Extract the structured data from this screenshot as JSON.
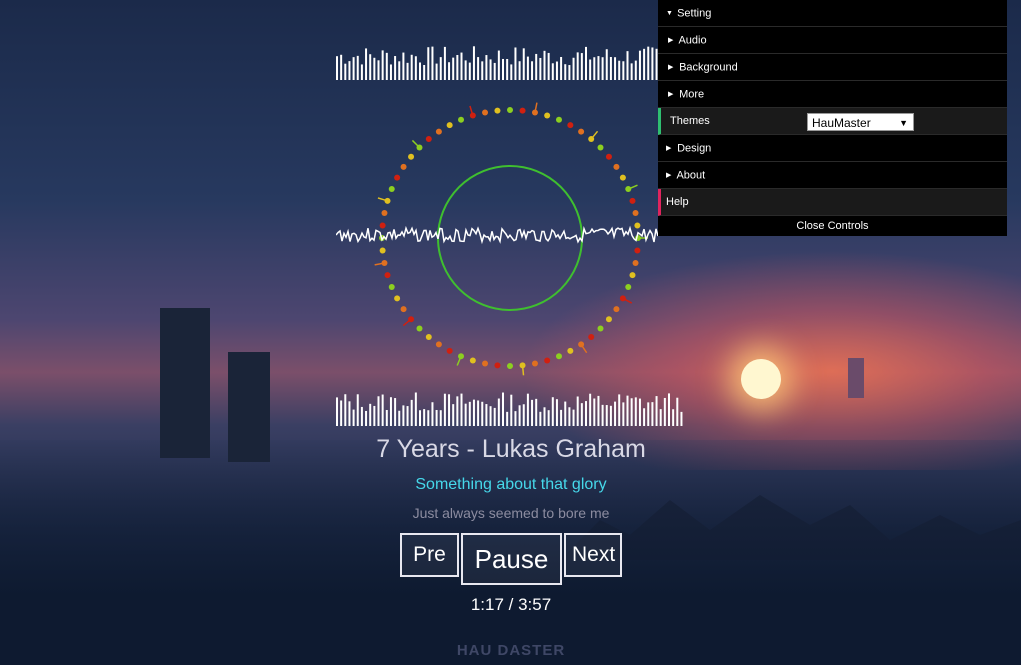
{
  "player": {
    "song_title": "7 Years - Lukas Graham",
    "lyric_current": "Something about that glory",
    "lyric_next": "Just always seemed to bore me",
    "controls": {
      "prev_label": "Pre",
      "pause_label": "Pause",
      "next_label": "Next"
    },
    "time": "1:17 / 3:57",
    "brand": "HAU DASTER",
    "progress": 0.3249
  },
  "panel": {
    "setting_label": "Setting",
    "items": [
      {
        "label": "Audio"
      },
      {
        "label": "Background"
      },
      {
        "label": "More"
      }
    ],
    "themes_label": "Themes",
    "themes_value": "HauMaster",
    "design_label": "Design",
    "about_label": "About",
    "help_label": "Help",
    "close_label": "Close Controls"
  },
  "colors": {
    "ring": "#3fbf2f",
    "lyric_accent": "#46d8ea",
    "themes_marker": "#2fbf71",
    "help_marker": "#e0245e",
    "dot_low": "#e0c020",
    "dot_mid": "#e07020",
    "dot_high": "#d02010",
    "dot_alt": "#8ccf20"
  },
  "icons": {
    "collapse": "triangle-down-icon",
    "expand": "triangle-right-icon",
    "dropdown": "chevron-down-icon"
  }
}
